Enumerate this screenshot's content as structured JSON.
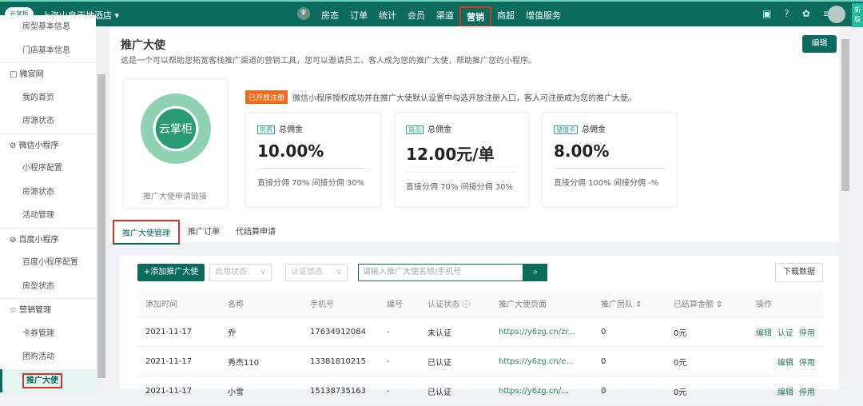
{
  "topbar": {
    "logo": "云掌柜",
    "hotel": "上海山泉天地酒店",
    "nav": [
      "房态",
      "订单",
      "统计",
      "会员",
      "渠道",
      "营销",
      "商超",
      "增值服务"
    ],
    "active": "营销",
    "new_version": "新版"
  },
  "sidebar": {
    "items": [
      {
        "label": "房型基本信息",
        "type": "item"
      },
      {
        "label": "门店基本信息",
        "type": "item"
      },
      {
        "label": "微官网",
        "type": "hd",
        "icon": "□"
      },
      {
        "label": "我的首页",
        "type": "item"
      },
      {
        "label": "房源状态",
        "type": "item"
      },
      {
        "label": "微信小程序",
        "type": "hd",
        "icon": "⊘"
      },
      {
        "label": "小程序配置",
        "type": "item"
      },
      {
        "label": "房源状态",
        "type": "item"
      },
      {
        "label": "活动管理",
        "type": "item"
      },
      {
        "label": "百度小程序",
        "type": "hd",
        "icon": "⊘"
      },
      {
        "label": "百度小程序配置",
        "type": "item"
      },
      {
        "label": "房型状态",
        "type": "item"
      },
      {
        "label": "营销管理",
        "type": "hd",
        "icon": "☆"
      },
      {
        "label": "卡券管理",
        "type": "item"
      },
      {
        "label": "团购活动",
        "type": "item"
      },
      {
        "label": "推广大使",
        "type": "on"
      }
    ]
  },
  "page": {
    "title": "推广大使",
    "desc": "这是一个可以帮助您拓宽客栈推广渠道的营销工具，您可以邀请员工、客人成为您的推广大使，帮助推广您的小程序。",
    "edit": "编辑",
    "qr_text": "云掌柜",
    "qr_label": "推广大使申请链接",
    "notice_badge": "已开放注册",
    "notice": "微信小程序授权成功并在推广大使默认设置中勾选开放注册入口，客人可注册成为您的推广大使。",
    "cards": [
      {
        "tag": "房费",
        "label": "总佣金",
        "value": "10.00%",
        "split": "直接分佣  70%  间接分佣  30%"
      },
      {
        "tag": "商品",
        "label": "总佣金",
        "value": "12.00元/单",
        "split": "直接分佣  70%  间接分佣  30%"
      },
      {
        "tag": "储值卡",
        "label": "总佣金",
        "value": "8.00%",
        "split": "直接分佣  100%  间接分佣  -%"
      }
    ],
    "tabs": [
      "推广大使管理",
      "推广订单",
      "代结算申请"
    ]
  },
  "toolbar": {
    "add": "+添加推广大使",
    "status": "启用状态",
    "auth": "认证状态",
    "search_placeholder": "请输入推广大使名称/手机号",
    "download": "下载数据"
  },
  "table": {
    "headers": [
      "添加时间",
      "名称",
      "手机号",
      "编号",
      "认证状态 ⓘ",
      "推广大使页面",
      "推广团队 ⇕",
      "已结算金额 ⇕",
      "操作"
    ],
    "rows": [
      {
        "cells": [
          "2021-11-17",
          "乔",
          "17634912084",
          "-",
          "未认证",
          "https://y6zg.cn/zr...",
          "0",
          "0元"
        ],
        "ops": [
          "编辑",
          "认证",
          "停用"
        ]
      },
      {
        "cells": [
          "2021-11-17",
          "秀杰110",
          "13381810215",
          "-",
          "已认证",
          "https://y6zg.cn/e...",
          "0",
          "0元"
        ],
        "ops": [
          "编辑",
          "停用"
        ]
      },
      {
        "cells": [
          "2021-11-17",
          "小雪",
          "15138735163",
          "-",
          "已认证",
          "https://y6zg.cn/...",
          "0",
          "0元"
        ],
        "ops": [
          "编辑",
          "停用"
        ]
      }
    ]
  }
}
